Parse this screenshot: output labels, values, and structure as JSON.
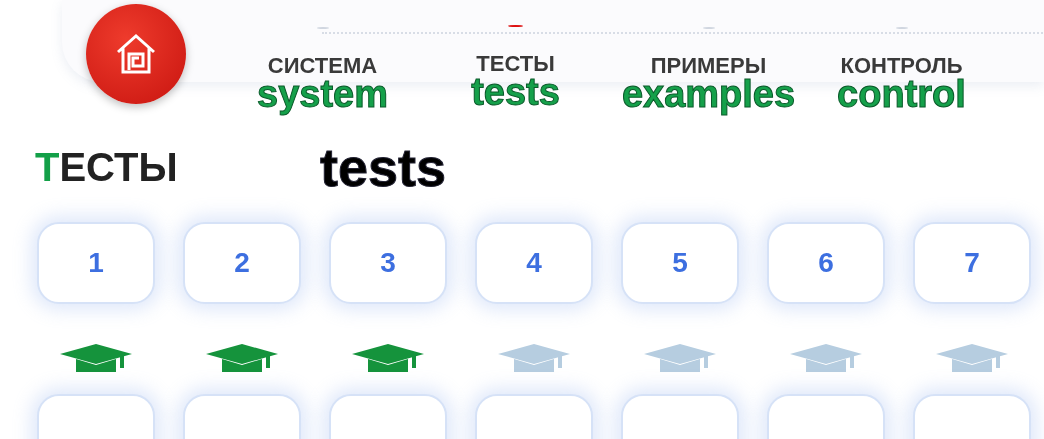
{
  "nav": {
    "items": [
      {
        "label": "СИСТЕМА",
        "note": "system",
        "selected": false
      },
      {
        "label": "ТЕСТЫ",
        "note": "tests",
        "selected": true
      },
      {
        "label": "ПРИМЕРЫ",
        "note": "examples",
        "selected": false
      },
      {
        "label": "КОНТРОЛЬ",
        "note": "control",
        "selected": false
      }
    ]
  },
  "heading": {
    "title": "ТЕСТЫ",
    "note": "tests"
  },
  "test_rows": [
    {
      "tiles": [
        {
          "label": "1",
          "passed": true
        },
        {
          "label": "2",
          "passed": true
        },
        {
          "label": "3",
          "passed": true
        },
        {
          "label": "4",
          "passed": false
        },
        {
          "label": "5",
          "passed": false
        },
        {
          "label": "6",
          "passed": false
        },
        {
          "label": "7",
          "passed": false
        }
      ]
    },
    {
      "tiles": [
        {
          "kind": "blank"
        },
        {
          "kind": "blank"
        },
        {
          "kind": "blank"
        },
        {
          "kind": "blank"
        },
        {
          "kind": "blank"
        },
        {
          "kind": "blank"
        },
        {
          "kind": "blank"
        }
      ]
    }
  ]
}
